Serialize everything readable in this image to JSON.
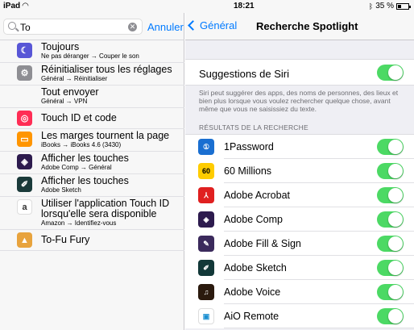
{
  "status": {
    "device": "iPad",
    "time": "18:21",
    "battery": "35 %",
    "battery_level": 0.35
  },
  "search": {
    "query": "To",
    "cancel_label": "Annuler"
  },
  "results": [
    {
      "title": "Toujours",
      "subtitle": "Ne pas déranger → Couper le son",
      "icon": "moon-icon",
      "color": "#5856d6"
    },
    {
      "title": "Réinitialiser tous les réglages",
      "subtitle": "Général → Réinitialiser",
      "icon": "gear-icon",
      "color": "#8e8e93"
    },
    {
      "title": "Tout envoyer",
      "subtitle": "Général → VPN",
      "icon": "",
      "color": ""
    },
    {
      "title": "Touch ID et code",
      "subtitle": "",
      "icon": "fingerprint-icon",
      "color": "#ff2d55"
    },
    {
      "title": "Les marges tournent la page",
      "subtitle": "iBooks → iBooks 4.6 (3430)",
      "icon": "ibooks-icon",
      "color": "#ff9500"
    },
    {
      "title": "Afficher les touches",
      "subtitle": "Adobe Comp → Général",
      "icon": "adobe-comp-icon",
      "color": "#2d1b4e"
    },
    {
      "title": "Afficher les touches",
      "subtitle": "Adobe Sketch",
      "icon": "adobe-sketch-icon",
      "color": "#1a3a3a"
    },
    {
      "title": "Utiliser l'application Touch ID lorsqu'elle sera disponible",
      "subtitle": "Amazon → Identifiez-vous",
      "icon": "amazon-icon",
      "color": "#ffffff"
    },
    {
      "title": "To-Fu Fury",
      "subtitle": "",
      "icon": "tofu-fury-icon",
      "color": "#e8a33d"
    }
  ],
  "nav": {
    "back_label": "Général",
    "title": "Recherche Spotlight"
  },
  "siri": {
    "label": "Suggestions de Siri",
    "enabled": true,
    "description": "Siri peut suggérer des apps, des noms de personnes, des lieux et bien plus lorsque vous voulez rechercher quelque chose, avant même que vous ne saisissiez du texte."
  },
  "section_header": "RÉSULTATS DE LA RECHERCHE",
  "apps": [
    {
      "name": "1Password",
      "icon": "1password-icon",
      "color": "#1a6fd1",
      "glyph": "①",
      "enabled": true
    },
    {
      "name": "60 Millions",
      "icon": "60-millions-icon",
      "color": "#ffcc00",
      "glyph": "60",
      "enabled": true
    },
    {
      "name": "Adobe Acrobat",
      "icon": "adobe-acrobat-icon",
      "color": "#e02020",
      "glyph": "⅄",
      "enabled": true
    },
    {
      "name": "Adobe Comp",
      "icon": "adobe-comp-icon",
      "color": "#2d1b4e",
      "glyph": "◈",
      "enabled": true
    },
    {
      "name": "Adobe Fill & Sign",
      "icon": "adobe-fill-sign-icon",
      "color": "#3b2a5c",
      "glyph": "✎",
      "enabled": true
    },
    {
      "name": "Adobe Sketch",
      "icon": "adobe-sketch-icon",
      "color": "#123838",
      "glyph": "✐",
      "enabled": true
    },
    {
      "name": "Adobe Voice",
      "icon": "adobe-voice-icon",
      "color": "#2b1a0e",
      "glyph": "♫",
      "enabled": true
    },
    {
      "name": "AiO Remote",
      "icon": "aio-remote-icon",
      "color": "#ffffff",
      "glyph": "▣",
      "enabled": true
    }
  ]
}
